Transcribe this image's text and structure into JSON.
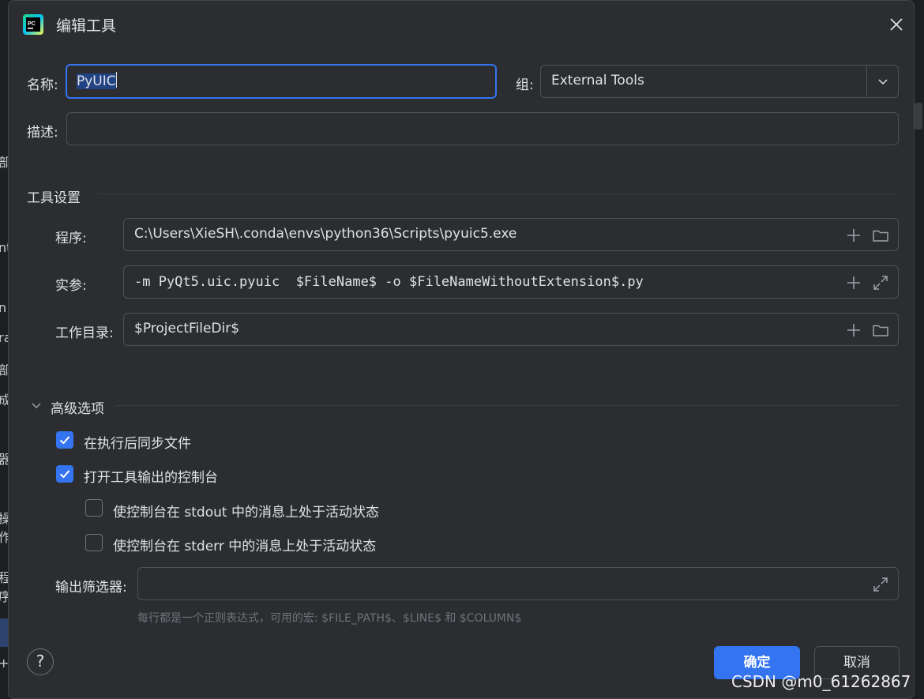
{
  "dialog": {
    "title": "编辑工具",
    "close_icon": "close-icon"
  },
  "name": {
    "label": "名称:",
    "value_selected": "PyUIC"
  },
  "group": {
    "label": "组:",
    "value": "External Tools"
  },
  "description": {
    "label": "描述:",
    "value": ""
  },
  "tool_settings": {
    "section_title": "工具设置",
    "program": {
      "label": "程序:",
      "value": "C:\\Users\\XieSH\\.conda\\envs\\python36\\Scripts\\pyuic5.exe"
    },
    "arguments": {
      "label": "实参:",
      "value": "-m PyQt5.uic.pyuic  $FileName$ -o $FileNameWithoutExtension$.py"
    },
    "working_dir": {
      "label": "工作目录:",
      "value": "$ProjectFileDir$"
    }
  },
  "advanced": {
    "section_title": "高级选项",
    "sync_files": {
      "label": "在执行后同步文件",
      "checked": true
    },
    "open_console": {
      "label": "打开工具输出的控制台",
      "checked": true
    },
    "activate_stdout": {
      "label": "使控制台在 stdout 中的消息上处于活动状态",
      "checked": false
    },
    "activate_stderr": {
      "label": "使控制台在 stderr 中的消息上处于活动状态",
      "checked": false
    },
    "output_filters": {
      "label": "输出筛选器:",
      "value": ""
    },
    "hint": "每行都是一个正则表达式，可用的宏: $FILE_PATH$、$LINE$ 和 $COLUMN$"
  },
  "footer": {
    "help": "?",
    "ok": "确定",
    "cancel": "取消"
  },
  "background_fragments": [
    "部",
    "nt",
    "n",
    "ra",
    "部",
    "成",
    "器",
    "操作",
    "程序",
    "+"
  ],
  "watermark": "CSDN @m0_61262867",
  "colors": {
    "accent": "#3574f0",
    "dialog_bg": "#2b2d30",
    "border": "#4e5157",
    "text": "#dfe1e5",
    "hint": "#6f737a"
  }
}
